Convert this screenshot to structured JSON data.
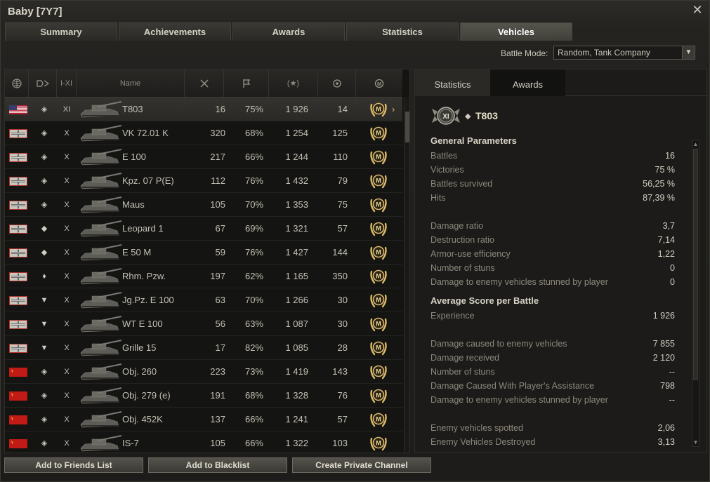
{
  "window": {
    "title": "Baby [7Y7]"
  },
  "tabs": [
    "Summary",
    "Achievements",
    "Awards",
    "Statistics",
    "Vehicles"
  ],
  "active_tab": "Vehicles",
  "battle_mode": {
    "label": "Battle Mode:",
    "value": "Random, Tank Company"
  },
  "table": {
    "headers": {
      "nation": "globe-icon",
      "class": "vehicle-type-icon",
      "tier": "I-XI",
      "name": "Name",
      "battles": "battles-icon",
      "wins": "victory-flag-icon",
      "exp": "(★)",
      "damage": "target-icon",
      "mastery": "mastery-badge-icon"
    },
    "rows": [
      {
        "nation": "usa",
        "class_icon": "heavy-tank",
        "tier": "XI",
        "name": "T803",
        "battles": "16",
        "wins": "75%",
        "exp": "1 926",
        "damage": "14",
        "selected": true
      },
      {
        "nation": "germany",
        "class_icon": "heavy-tank",
        "tier": "X",
        "name": "VK 72.01 K",
        "battles": "320",
        "wins": "68%",
        "exp": "1 254",
        "damage": "125"
      },
      {
        "nation": "germany",
        "class_icon": "heavy-tank",
        "tier": "X",
        "name": "E 100",
        "battles": "217",
        "wins": "66%",
        "exp": "1 244",
        "damage": "110"
      },
      {
        "nation": "germany",
        "class_icon": "heavy-tank",
        "tier": "X",
        "name": "Kpz. 07 P(E)",
        "battles": "112",
        "wins": "76%",
        "exp": "1 432",
        "damage": "79"
      },
      {
        "nation": "germany",
        "class_icon": "heavy-tank",
        "tier": "X",
        "name": "Maus",
        "battles": "105",
        "wins": "70%",
        "exp": "1 353",
        "damage": "75"
      },
      {
        "nation": "germany",
        "class_icon": "medium-tank",
        "tier": "X",
        "name": "Leopard 1",
        "battles": "67",
        "wins": "69%",
        "exp": "1 321",
        "damage": "57"
      },
      {
        "nation": "germany",
        "class_icon": "medium-tank",
        "tier": "X",
        "name": "E 50 M",
        "battles": "59",
        "wins": "76%",
        "exp": "1 427",
        "damage": "144"
      },
      {
        "nation": "germany",
        "class_icon": "light-tank",
        "tier": "X",
        "name": "Rhm. Pzw.",
        "battles": "197",
        "wins": "62%",
        "exp": "1 165",
        "damage": "350"
      },
      {
        "nation": "germany",
        "class_icon": "tank-destroyer",
        "tier": "X",
        "name": "Jg.Pz. E 100",
        "battles": "63",
        "wins": "70%",
        "exp": "1 266",
        "damage": "30"
      },
      {
        "nation": "germany",
        "class_icon": "tank-destroyer",
        "tier": "X",
        "name": "WT E 100",
        "battles": "56",
        "wins": "63%",
        "exp": "1 087",
        "damage": "30"
      },
      {
        "nation": "germany",
        "class_icon": "tank-destroyer",
        "tier": "X",
        "name": "Grille 15",
        "battles": "17",
        "wins": "82%",
        "exp": "1 085",
        "damage": "28"
      },
      {
        "nation": "ussr",
        "class_icon": "heavy-tank",
        "tier": "X",
        "name": "Obj. 260",
        "battles": "223",
        "wins": "73%",
        "exp": "1 419",
        "damage": "143"
      },
      {
        "nation": "ussr",
        "class_icon": "heavy-tank",
        "tier": "X",
        "name": "Obj. 279 (e)",
        "battles": "191",
        "wins": "68%",
        "exp": "1 328",
        "damage": "76"
      },
      {
        "nation": "ussr",
        "class_icon": "heavy-tank",
        "tier": "X",
        "name": "Obj. 452K",
        "battles": "137",
        "wins": "66%",
        "exp": "1 241",
        "damage": "57"
      },
      {
        "nation": "ussr",
        "class_icon": "heavy-tank",
        "tier": "X",
        "name": "IS-7",
        "battles": "105",
        "wins": "66%",
        "exp": "1 322",
        "damage": "103"
      }
    ],
    "mastery_label": "M",
    "selected_arrow": "›"
  },
  "right_panel": {
    "tabs": [
      "Statistics",
      "Awards"
    ],
    "active_tab": "Statistics",
    "vehicle": {
      "tier_badge": "XI",
      "name": "T803"
    },
    "sections": [
      {
        "title": "General Parameters",
        "lines": [
          {
            "label": "Battles",
            "value": "16"
          },
          {
            "label": "Victories",
            "value": "75 %"
          },
          {
            "label": "Battles survived",
            "value": "56,25 %"
          },
          {
            "label": "Hits",
            "value": "87,39 %"
          },
          {
            "label": "",
            "value": ""
          },
          {
            "label": "Damage ratio",
            "value": "3,7"
          },
          {
            "label": "Destruction ratio",
            "value": "7,14"
          },
          {
            "label": "Armor-use efficiency",
            "value": "1,22"
          },
          {
            "label": "Number of stuns",
            "value": "0"
          },
          {
            "label": "Damage to enemy vehicles stunned by player",
            "value": "0"
          }
        ]
      },
      {
        "title": "Average Score per Battle",
        "lines": [
          {
            "label": "Experience",
            "value": "1 926"
          },
          {
            "label": "",
            "value": ""
          },
          {
            "label": "Damage caused to enemy vehicles",
            "value": "7 855"
          },
          {
            "label": "Damage received",
            "value": "2 120"
          },
          {
            "label": "Number of stuns",
            "value": "--"
          },
          {
            "label": "Damage Caused With Player's Assistance",
            "value": "798"
          },
          {
            "label": "Damage to enemy vehicles stunned by player",
            "value": "--"
          },
          {
            "label": "",
            "value": ""
          },
          {
            "label": "Enemy vehicles spotted",
            "value": "2,06"
          },
          {
            "label": "Enemy Vehicles Destroyed",
            "value": "3,13"
          }
        ]
      }
    ]
  },
  "buttons": [
    "Add to Friends List",
    "Add to Blacklist",
    "Create Private Channel"
  ],
  "colors": {
    "gold": "#d9b768",
    "text": "#c4c0b3",
    "bg": "#141413"
  }
}
